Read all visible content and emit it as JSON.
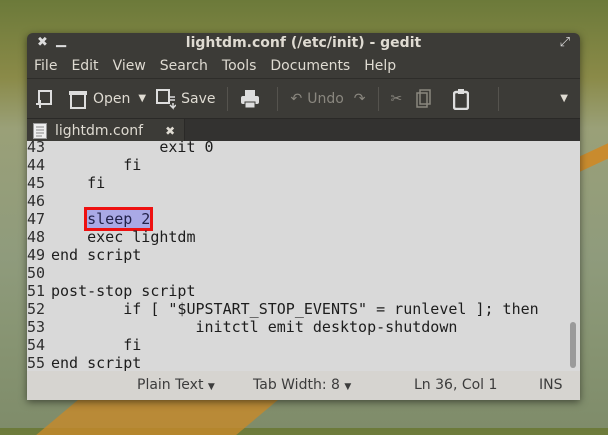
{
  "window": {
    "title": "lightdm.conf (/etc/init) - gedit"
  },
  "menu": [
    "File",
    "Edit",
    "View",
    "Search",
    "Tools",
    "Documents",
    "Help"
  ],
  "toolbar": {
    "open": "Open",
    "save": "Save",
    "undo": "Undo"
  },
  "tab": {
    "label": "lightdm.conf"
  },
  "lines": [
    {
      "n": "43",
      "t": "            exit 0"
    },
    {
      "n": "44",
      "t": "        fi"
    },
    {
      "n": "45",
      "t": "    fi"
    },
    {
      "n": "46",
      "t": ""
    },
    {
      "n": "47",
      "t": "    ",
      "sel": "sleep 2"
    },
    {
      "n": "48",
      "t": "    exec lightdm"
    },
    {
      "n": "49",
      "t": "end script"
    },
    {
      "n": "50",
      "t": ""
    },
    {
      "n": "51",
      "t": "post-stop script"
    },
    {
      "n": "52",
      "t": "        if [ \"$UPSTART_STOP_EVENTS\" = runlevel ]; then"
    },
    {
      "n": "53",
      "t": "                initctl emit desktop-shutdown"
    },
    {
      "n": "54",
      "t": "        fi"
    },
    {
      "n": "55",
      "t": "end script"
    }
  ],
  "status": {
    "language": "Plain Text",
    "tab_width": "Tab Width:  8",
    "position": "Ln 36, Col 1",
    "mode": "INS"
  }
}
